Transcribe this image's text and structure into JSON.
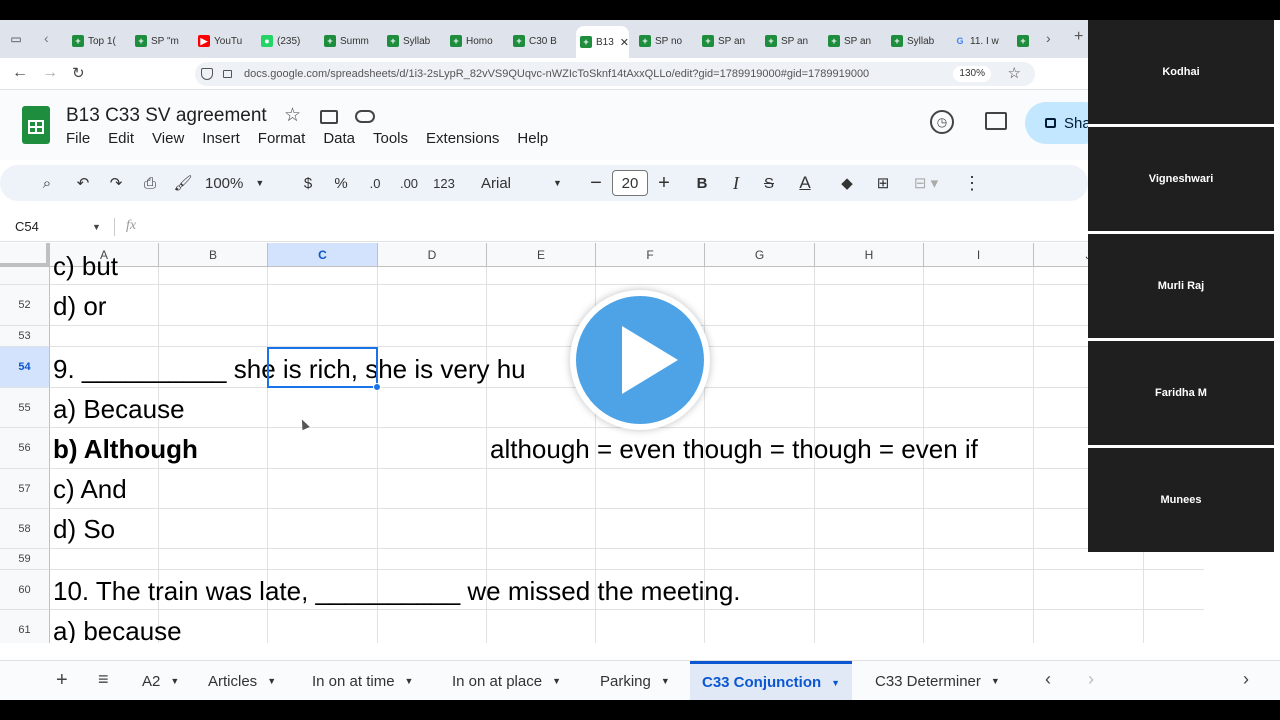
{
  "browser": {
    "tabs": [
      {
        "title": "Top 1(",
        "fav": "sheets"
      },
      {
        "title": "SP \"m",
        "fav": "sheets"
      },
      {
        "title": "YouTu",
        "fav": "youtube"
      },
      {
        "title": "(235) ",
        "fav": "whatsapp"
      },
      {
        "title": "Summ",
        "fav": "sheets"
      },
      {
        "title": "Syllab",
        "fav": "sheets"
      },
      {
        "title": "Homo",
        "fav": "sheets"
      },
      {
        "title": "C30 B",
        "fav": "sheets"
      },
      {
        "title": "B13",
        "fav": "sheets"
      },
      {
        "title": "SP no",
        "fav": "sheets"
      },
      {
        "title": "SP an",
        "fav": "sheets"
      },
      {
        "title": "SP an",
        "fav": "sheets"
      },
      {
        "title": "SP an",
        "fav": "sheets"
      },
      {
        "title": "Syllab",
        "fav": "sheets"
      },
      {
        "title": "11. I w",
        "fav": "google"
      },
      {
        "title": "",
        "fav": "sheets"
      }
    ],
    "url": "docs.google.com/spreadsheets/d/1i3-2sLypR_82vVS9QUqvc-nWZIcToSknf14tAxxQLLo/edit?gid=1789919000#gid=1789919000",
    "zoom": "130%",
    "colors": {
      "sheets_green": "#1e8e3e",
      "youtube_red": "#ff0000",
      "accent_blue": "#0b57d0"
    }
  },
  "app": {
    "doc_title": "B13 C33 SV agreement",
    "menu": [
      "File",
      "Edit",
      "View",
      "Insert",
      "Format",
      "Data",
      "Tools",
      "Extensions",
      "Help"
    ],
    "share_label": "Sha"
  },
  "toolbar": {
    "zoom": "100%",
    "currency": "$",
    "percent": "%",
    "dec_decrease": ".0",
    "dec_increase": ".00",
    "number_format": "123",
    "font": "Arial",
    "font_size": "20",
    "bold": "B",
    "italic": "I",
    "strike": "S",
    "text_color": "A"
  },
  "formula_bar": {
    "name_box": "C54",
    "fx": "fx"
  },
  "grid": {
    "columns": [
      "A",
      "B",
      "C",
      "D",
      "E",
      "F",
      "G",
      "H",
      "I",
      "J"
    ],
    "selected_column": "C",
    "rows": [
      "52",
      "53",
      "54",
      "55",
      "56",
      "57",
      "58",
      "59",
      "60",
      "61"
    ],
    "selected_row": "54",
    "cells": {
      "r51_a": "c) but",
      "r52_a": "d) or",
      "r54_a": "9. __________ she is rich, she is very hu",
      "r55_a": "a) Because",
      "r56_a": "b) Although",
      "r56_d": "although = even though = though = even if",
      "r57_a": "c) And",
      "r58_a": "d) So",
      "r60_a": "10. The train was late, __________ we missed the meeting.",
      "r61_a": "a) because"
    }
  },
  "sheets": {
    "tabs": [
      "A2",
      "Articles",
      "In on at time",
      "In on at place",
      "Parking",
      "C33 Conjunction",
      "C33 Determiner"
    ],
    "active": "C33 Conjunction"
  },
  "participants": [
    "Kodhai",
    "Vigneshwari",
    "Murli Raj",
    "Faridha M",
    "Munees"
  ]
}
